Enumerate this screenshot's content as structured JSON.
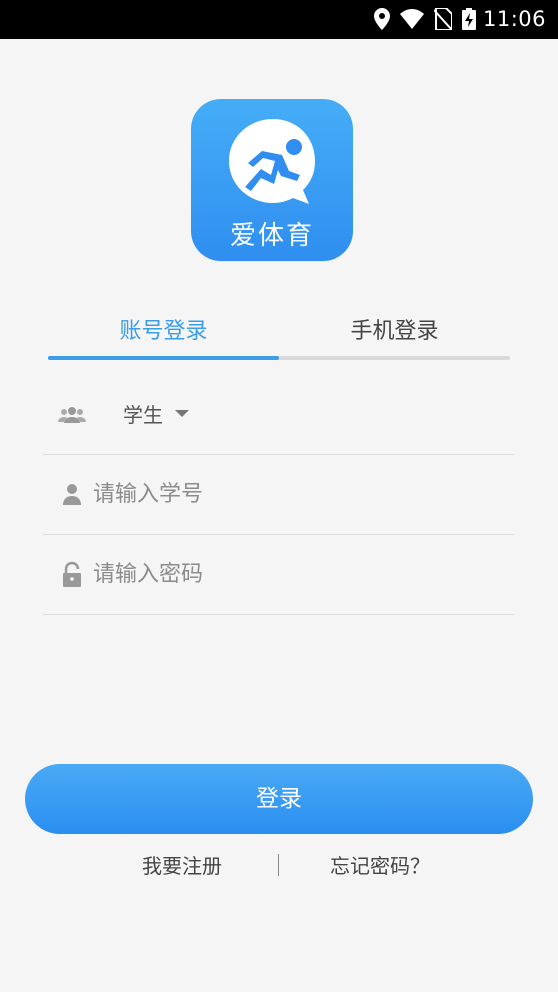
{
  "status_bar": {
    "time": "11:06"
  },
  "logo": {
    "text": "爱体育"
  },
  "tabs": {
    "account": "账号登录",
    "phone": "手机登录"
  },
  "form": {
    "role_value": "学生",
    "student_id_placeholder": "请输入学号",
    "password_placeholder": "请输入密码"
  },
  "login_button": "登录",
  "links": {
    "register": "我要注册",
    "separator": "|",
    "forgot": "忘记密码？"
  },
  "colors": {
    "accent": "#3a9de8",
    "background": "#f5f5f5",
    "button": "#2a8ef0"
  }
}
